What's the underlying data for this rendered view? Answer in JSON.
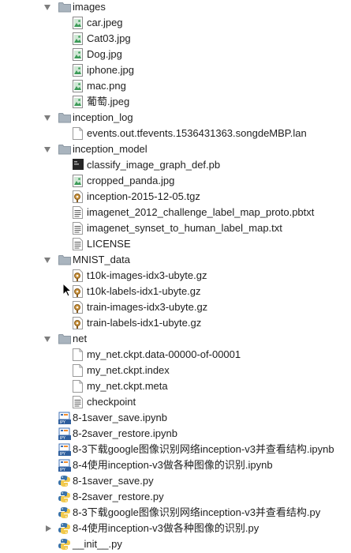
{
  "tree": [
    {
      "label": "images",
      "type": "folder",
      "depth": 0,
      "expanded": true
    },
    {
      "label": "car.jpeg",
      "type": "image",
      "depth": 1
    },
    {
      "label": "Cat03.jpg",
      "type": "image",
      "depth": 1
    },
    {
      "label": "Dog.jpg",
      "type": "image",
      "depth": 1
    },
    {
      "label": "iphone.jpg",
      "type": "image",
      "depth": 1
    },
    {
      "label": "mac.png",
      "type": "image",
      "depth": 1
    },
    {
      "label": "葡萄.jpeg",
      "type": "image",
      "depth": 1
    },
    {
      "label": "inception_log",
      "type": "folder",
      "depth": 0,
      "expanded": true
    },
    {
      "label": "events.out.tfevents.1536431363.songdeMBP.lan",
      "type": "file",
      "depth": 1
    },
    {
      "label": "inception_model",
      "type": "folder",
      "depth": 0,
      "expanded": true
    },
    {
      "label": "classify_image_graph_def.pb",
      "type": "binary",
      "depth": 1
    },
    {
      "label": "cropped_panda.jpg",
      "type": "image",
      "depth": 1
    },
    {
      "label": "inception-2015-12-05.tgz",
      "type": "archive",
      "depth": 1
    },
    {
      "label": "imagenet_2012_challenge_label_map_proto.pbtxt",
      "type": "text",
      "depth": 1
    },
    {
      "label": "imagenet_synset_to_human_label_map.txt",
      "type": "text",
      "depth": 1
    },
    {
      "label": "LICENSE",
      "type": "text",
      "depth": 1
    },
    {
      "label": "MNIST_data",
      "type": "folder",
      "depth": 0,
      "expanded": true
    },
    {
      "label": "t10k-images-idx3-ubyte.gz",
      "type": "archive",
      "depth": 1
    },
    {
      "label": "t10k-labels-idx1-ubyte.gz",
      "type": "archive",
      "depth": 1
    },
    {
      "label": "train-images-idx3-ubyte.gz",
      "type": "archive",
      "depth": 1
    },
    {
      "label": "train-labels-idx1-ubyte.gz",
      "type": "archive",
      "depth": 1
    },
    {
      "label": "net",
      "type": "folder",
      "depth": 0,
      "expanded": true
    },
    {
      "label": "my_net.ckpt.data-00000-of-00001",
      "type": "file",
      "depth": 1
    },
    {
      "label": "my_net.ckpt.index",
      "type": "file",
      "depth": 1
    },
    {
      "label": "my_net.ckpt.meta",
      "type": "file",
      "depth": 1
    },
    {
      "label": "checkpoint",
      "type": "text",
      "depth": 1
    },
    {
      "label": "8-1saver_save.ipynb",
      "type": "ipynb",
      "depth": 0
    },
    {
      "label": "8-2saver_restore.ipynb",
      "type": "ipynb",
      "depth": 0
    },
    {
      "label": "8-3下载google图像识别网络inception-v3并查看结构.ipynb",
      "type": "ipynb",
      "depth": 0
    },
    {
      "label": "8-4使用inception-v3做各种图像的识别.ipynb",
      "type": "ipynb",
      "depth": 0
    },
    {
      "label": "8-1saver_save.py",
      "type": "python",
      "depth": 0
    },
    {
      "label": "8-2saver_restore.py",
      "type": "python",
      "depth": 0
    },
    {
      "label": "8-3下载google图像识别网络inception-v3并查看结构.py",
      "type": "python",
      "depth": 0
    },
    {
      "label": "8-4使用inception-v3做各种图像的识别.py",
      "type": "python",
      "depth": 0,
      "expander": "collapsed"
    },
    {
      "label": "__init__.py",
      "type": "python",
      "depth": 0
    }
  ],
  "icons": {
    "folder": "folder-icon",
    "image": "image-file-icon",
    "file": "file-icon",
    "binary": "binary-file-icon",
    "archive": "archive-file-icon",
    "text": "text-file-icon",
    "ipynb": "ipynb-file-icon",
    "python": "python-file-icon"
  }
}
